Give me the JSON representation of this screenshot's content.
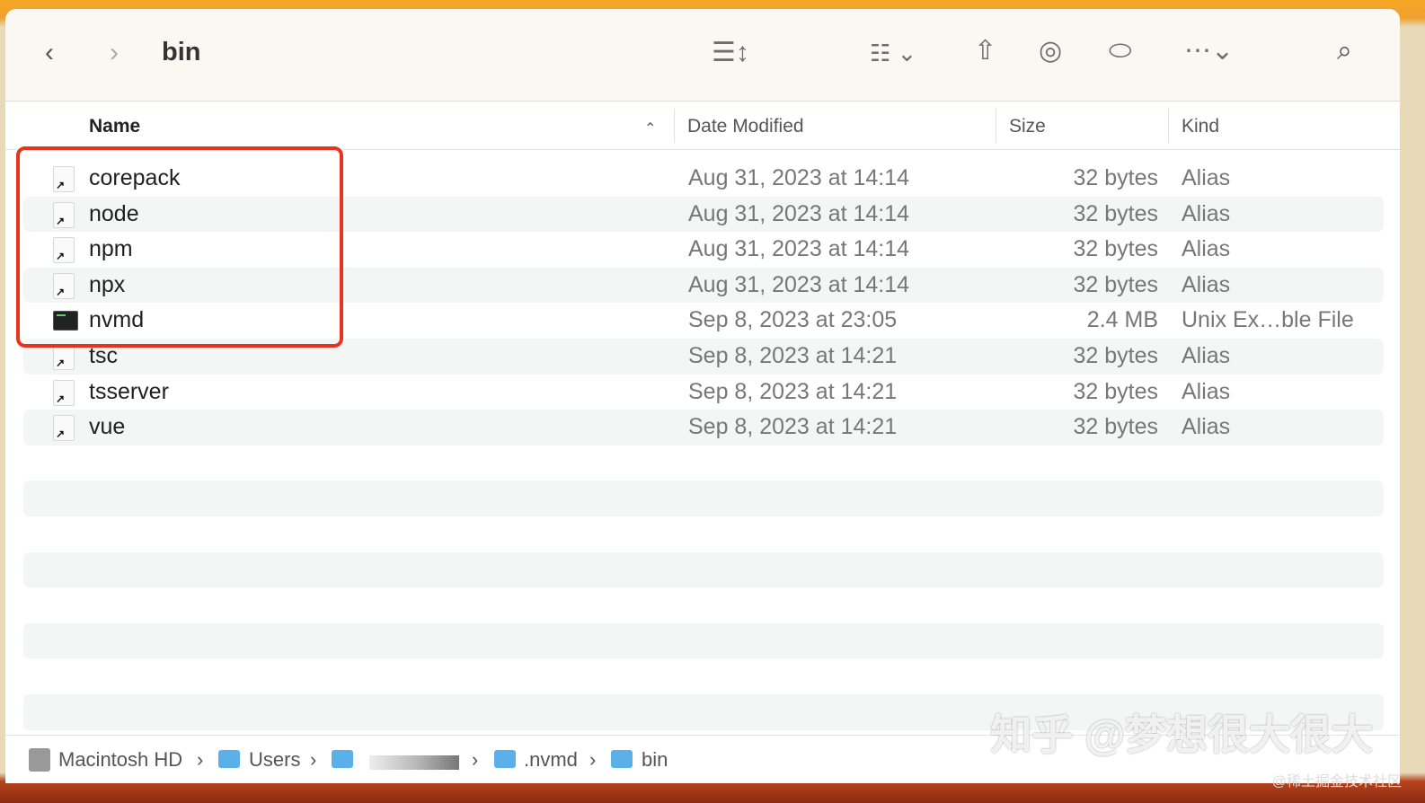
{
  "toolbar": {
    "title": "bin",
    "back_icon": "chevron-left",
    "forward_icon": "chevron-right",
    "view_icon": "list",
    "group_icon": "grid",
    "share_icon": "share",
    "airdrop_icon": "airdrop",
    "tag_icon": "tag",
    "more_icon": "ellipsis",
    "search_icon": "magnifier"
  },
  "columns": {
    "name": "Name",
    "date": "Date Modified",
    "size": "Size",
    "kind": "Kind"
  },
  "files": [
    {
      "name": "corepack",
      "date": "Aug 31, 2023 at 14:14",
      "size": "32 bytes",
      "kind": "Alias",
      "type": "alias"
    },
    {
      "name": "node",
      "date": "Aug 31, 2023 at 14:14",
      "size": "32 bytes",
      "kind": "Alias",
      "type": "alias"
    },
    {
      "name": "npm",
      "date": "Aug 31, 2023 at 14:14",
      "size": "32 bytes",
      "kind": "Alias",
      "type": "alias"
    },
    {
      "name": "npx",
      "date": "Aug 31, 2023 at 14:14",
      "size": "32 bytes",
      "kind": "Alias",
      "type": "alias"
    },
    {
      "name": "nvmd",
      "date": "Sep 8, 2023 at 23:05",
      "size": "2.4 MB",
      "kind": "Unix Ex…ble File",
      "type": "exec"
    },
    {
      "name": "tsc",
      "date": "Sep 8, 2023 at 14:21",
      "size": "32 bytes",
      "kind": "Alias",
      "type": "alias"
    },
    {
      "name": "tsserver",
      "date": "Sep 8, 2023 at 14:21",
      "size": "32 bytes",
      "kind": "Alias",
      "type": "alias"
    },
    {
      "name": "vue",
      "date": "Sep 8, 2023 at 14:21",
      "size": "32 bytes",
      "kind": "Alias",
      "type": "alias"
    }
  ],
  "path": [
    "Macintosh HD",
    "Users",
    "",
    ".nvmd",
    "bin"
  ],
  "watermark": "知乎 @梦想很大很大",
  "watermark2": "@稀土掘金技术社区"
}
